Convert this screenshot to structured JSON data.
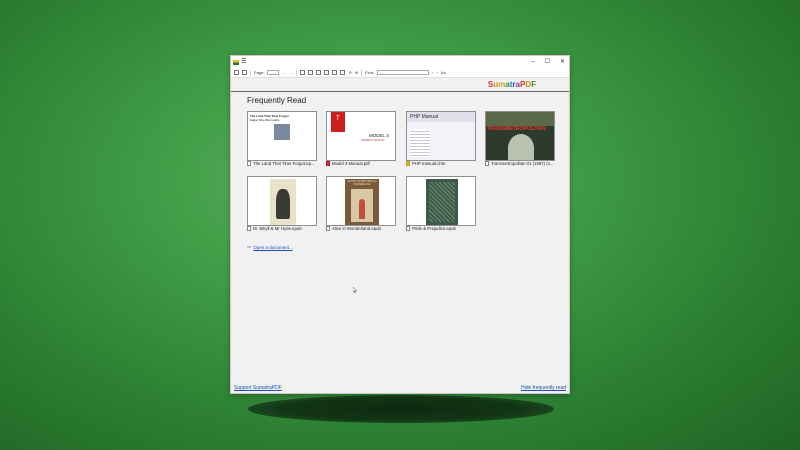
{
  "window": {
    "controls": [
      "–",
      "☐",
      "✕"
    ]
  },
  "toolbar": {
    "page_label": "Page:",
    "find_label": "Find:",
    "icons": [
      "open-icon",
      "print-icon",
      "first-page-icon",
      "prev-page-icon",
      "single-page-icon",
      "two-page-icon",
      "fit-width-icon",
      "fit-page-icon",
      "rotate-left-icon",
      "rotate-right-icon",
      "zoom-out-icon",
      "zoom-in-icon",
      "find-prev-icon",
      "find-next-icon",
      "match-case-icon"
    ]
  },
  "brand": {
    "letters": [
      "S",
      "u",
      "m",
      "a",
      "t",
      "r",
      "a",
      "P",
      "D",
      "F"
    ],
    "colors": [
      "#c63a2f",
      "#d9861f",
      "#c9a820",
      "#3a8f3a",
      "#1f7dc4",
      "#2a4fa8",
      "#8a3aa0",
      "#c63a2f",
      "#d9861f",
      "#3a8f3a"
    ]
  },
  "home": {
    "heading": "Frequently Read",
    "items": [
      {
        "caption": "The Land That Time Forgot.ep...",
        "type": "epub",
        "cover_title": "The Land That Time Forgot",
        "cover_author": "Edgar Rice Burroughs"
      },
      {
        "caption": "Model 3 Manual.pdf",
        "type": "pdf",
        "cover_title": "MODEL 3",
        "cover_sub": "OWNER'S MANUAL"
      },
      {
        "caption": "PHP manual.chm",
        "type": "chm",
        "cover_title": "PHP Manual"
      },
      {
        "caption": "Transmetropolitan 01 (1997) (n...",
        "type": "cbz",
        "cover_title": "TRANSMETROPOLITAN"
      },
      {
        "caption": "Dr Jekyll & Mr Hyde.epub",
        "type": "epub"
      },
      {
        "caption": "Alice in Wonderland.epub",
        "type": "epub",
        "cover_title": "ALICE'S ADVENTURES IN WONDERLAND"
      },
      {
        "caption": "Pride & Prejudice.epub",
        "type": "epub"
      }
    ],
    "open_document": "Open a document..."
  },
  "footer": {
    "support": "Support SumatraPDF",
    "hide": "Hide frequently read"
  }
}
